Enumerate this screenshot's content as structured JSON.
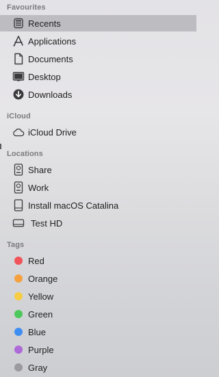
{
  "favourites": {
    "header": "Favourites",
    "items": [
      {
        "label": "Recents",
        "icon": "recents-icon",
        "selected": true
      },
      {
        "label": "Applications",
        "icon": "applications-icon"
      },
      {
        "label": "Documents",
        "icon": "documents-icon"
      },
      {
        "label": "Desktop",
        "icon": "desktop-icon"
      },
      {
        "label": "Downloads",
        "icon": "downloads-icon"
      }
    ]
  },
  "icloud": {
    "header": "iCloud",
    "items": [
      {
        "label": "iCloud Drive",
        "icon": "cloud-icon"
      }
    ]
  },
  "locations": {
    "header": "Locations",
    "items": [
      {
        "label": "Share",
        "icon": "server-disk-icon"
      },
      {
        "label": "Work",
        "icon": "server-disk-icon"
      },
      {
        "label": "Install macOS Catalina",
        "icon": "disk-icon"
      },
      {
        "label": "Test HD",
        "icon": "disk-icon"
      }
    ]
  },
  "tags": {
    "header": "Tags",
    "items": [
      {
        "label": "Red",
        "color": "#f0545a"
      },
      {
        "label": "Orange",
        "color": "#f5a140"
      },
      {
        "label": "Yellow",
        "color": "#f6cd44"
      },
      {
        "label": "Green",
        "color": "#4dc85d"
      },
      {
        "label": "Blue",
        "color": "#3f8ef2"
      },
      {
        "label": "Purple",
        "color": "#ad6ad8"
      },
      {
        "label": "Gray",
        "color": "#9b9b9f"
      }
    ]
  }
}
